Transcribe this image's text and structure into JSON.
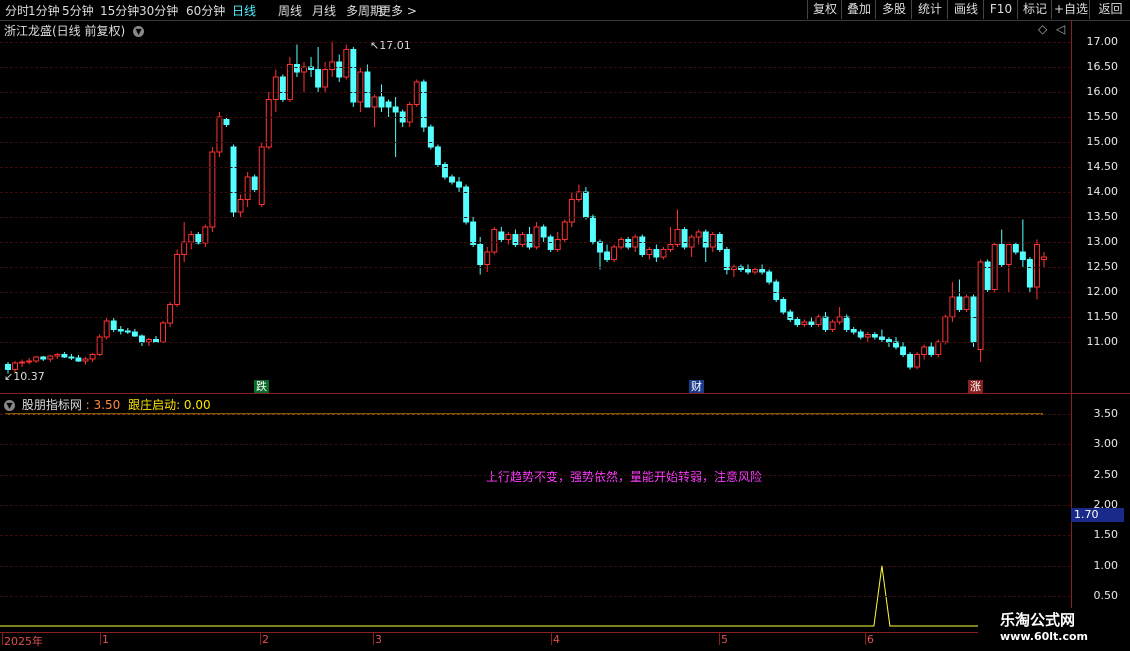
{
  "toolbar": {
    "periods": [
      "分时",
      "1分钟",
      "5分钟",
      "15分钟",
      "30分钟",
      "60分钟",
      "日线",
      "周线",
      "月线",
      "多周期",
      "更多 >"
    ],
    "active_period": "日线",
    "buttons": [
      "复权",
      "叠加",
      "多股",
      "统计",
      "画线",
      "F10",
      "标记",
      "+自选",
      "返回"
    ]
  },
  "chart_title": "浙江龙盛(日线 前复权)",
  "price_axis": [
    "17.00",
    "16.50",
    "16.00",
    "15.50",
    "15.00",
    "14.50",
    "14.00",
    "13.50",
    "13.00",
    "12.50",
    "12.00",
    "11.50",
    "11.00"
  ],
  "high_label": "17.01",
  "low_label": "10.37",
  "markers": {
    "die": "跌",
    "cai": "财",
    "zhang": "涨"
  },
  "indicator": {
    "name": "股朋指标网",
    "value": ": 3.50",
    "line_label": "跟庄启动: 0.00",
    "message": "上行趋势不变，强势依然，量能开始转弱，注意风险",
    "axis": [
      "3.50",
      "3.00",
      "2.50",
      "2.00",
      "1.50",
      "1.00",
      "0.50"
    ],
    "cursor_value": "1.70"
  },
  "dates": [
    "2025年",
    "1",
    "2",
    "3",
    "4",
    "5",
    "6"
  ],
  "watermark": {
    "line1": "乐淘公式网",
    "line2": "www.60lt.com"
  },
  "colors": {
    "up": "#ff3232",
    "down": "#54ffff",
    "axis": "#8a1f1f",
    "ind_line": "#ffb000",
    "spike": "#ffff40"
  },
  "chart_data": {
    "type": "candlestick",
    "candles": [
      [
        10.55,
        10.6,
        10.37,
        10.45
      ],
      [
        10.45,
        10.62,
        10.4,
        10.58
      ],
      [
        10.58,
        10.65,
        10.5,
        10.6
      ],
      [
        10.6,
        10.68,
        10.55,
        10.62
      ],
      [
        10.62,
        10.72,
        10.58,
        10.7
      ],
      [
        10.7,
        10.72,
        10.62,
        10.66
      ],
      [
        10.66,
        10.74,
        10.6,
        10.72
      ],
      [
        10.72,
        10.78,
        10.66,
        10.75
      ],
      [
        10.75,
        10.8,
        10.68,
        10.7
      ],
      [
        10.7,
        10.76,
        10.64,
        10.68
      ],
      [
        10.68,
        10.74,
        10.6,
        10.62
      ],
      [
        10.62,
        10.7,
        10.55,
        10.66
      ],
      [
        10.66,
        10.78,
        10.6,
        10.75
      ],
      [
        10.75,
        11.15,
        10.72,
        11.1
      ],
      [
        11.1,
        11.5,
        11.05,
        11.42
      ],
      [
        11.42,
        11.48,
        11.2,
        11.25
      ],
      [
        11.25,
        11.32,
        11.15,
        11.22
      ],
      [
        11.22,
        11.28,
        11.16,
        11.2
      ],
      [
        11.2,
        11.26,
        11.1,
        11.12
      ],
      [
        11.12,
        11.15,
        10.92,
        11.0
      ],
      [
        11.0,
        11.08,
        10.92,
        11.05
      ],
      [
        11.05,
        11.12,
        10.98,
        11.0
      ],
      [
        11.0,
        11.42,
        10.98,
        11.38
      ],
      [
        11.38,
        11.8,
        11.3,
        11.75
      ],
      [
        11.75,
        12.85,
        11.7,
        12.75
      ],
      [
        12.75,
        13.4,
        12.6,
        13.0
      ],
      [
        13.0,
        13.22,
        12.85,
        13.15
      ],
      [
        13.15,
        13.2,
        12.95,
        12.98
      ],
      [
        12.98,
        13.35,
        12.9,
        13.3
      ],
      [
        13.3,
        14.9,
        13.2,
        14.8
      ],
      [
        14.8,
        15.6,
        14.7,
        15.5
      ],
      [
        15.45,
        15.5,
        15.3,
        15.35
      ],
      [
        14.9,
        14.95,
        13.5,
        13.6
      ],
      [
        13.6,
        13.95,
        13.5,
        13.85
      ],
      [
        13.85,
        14.4,
        13.7,
        14.3
      ],
      [
        14.3,
        14.35,
        14.0,
        14.05
      ],
      [
        13.75,
        15.0,
        13.7,
        14.9
      ],
      [
        14.9,
        16.0,
        14.85,
        15.85
      ],
      [
        15.85,
        16.45,
        15.6,
        16.3
      ],
      [
        16.3,
        16.35,
        15.8,
        15.85
      ],
      [
        15.85,
        16.7,
        15.8,
        16.55
      ],
      [
        16.55,
        16.95,
        16.3,
        16.4
      ],
      [
        16.4,
        16.6,
        16.0,
        16.5
      ],
      [
        16.5,
        16.7,
        16.3,
        16.45
      ],
      [
        16.45,
        16.9,
        16.0,
        16.1
      ],
      [
        16.1,
        16.6,
        16.0,
        16.45
      ],
      [
        16.45,
        17.01,
        16.3,
        16.6
      ],
      [
        16.6,
        16.75,
        16.2,
        16.3
      ],
      [
        16.3,
        16.95,
        16.25,
        16.85
      ],
      [
        16.85,
        16.9,
        15.7,
        15.8
      ],
      [
        15.8,
        16.5,
        15.6,
        16.4
      ],
      [
        16.4,
        16.55,
        15.95,
        15.7
      ],
      [
        15.7,
        15.95,
        15.3,
        15.9
      ],
      [
        15.9,
        16.15,
        15.6,
        15.7
      ],
      [
        15.8,
        15.85,
        15.5,
        15.7
      ],
      [
        15.7,
        15.9,
        14.7,
        15.6
      ],
      [
        15.6,
        15.65,
        15.3,
        15.4
      ],
      [
        15.4,
        15.8,
        15.3,
        15.75
      ],
      [
        15.75,
        16.25,
        15.7,
        16.2
      ],
      [
        16.2,
        16.25,
        15.2,
        15.3
      ],
      [
        15.3,
        15.35,
        14.85,
        14.9
      ],
      [
        14.9,
        14.95,
        14.5,
        14.55
      ],
      [
        14.55,
        14.6,
        14.25,
        14.3
      ],
      [
        14.3,
        14.35,
        14.15,
        14.2
      ],
      [
        14.2,
        14.3,
        14.0,
        14.1
      ],
      [
        14.1,
        14.15,
        13.35,
        13.4
      ],
      [
        13.4,
        13.5,
        12.9,
        12.95
      ],
      [
        12.95,
        13.1,
        12.35,
        12.55
      ],
      [
        12.55,
        12.9,
        12.4,
        12.8
      ],
      [
        12.8,
        13.3,
        12.75,
        13.25
      ],
      [
        13.2,
        13.3,
        13.0,
        13.05
      ],
      [
        13.05,
        13.2,
        12.95,
        13.15
      ],
      [
        13.15,
        13.25,
        12.9,
        12.95
      ],
      [
        12.95,
        13.2,
        12.9,
        13.15
      ],
      [
        13.15,
        13.3,
        12.85,
        12.9
      ],
      [
        12.9,
        13.4,
        12.85,
        13.3
      ],
      [
        13.3,
        13.35,
        13.0,
        13.1
      ],
      [
        13.1,
        13.15,
        12.8,
        12.85
      ],
      [
        12.85,
        13.2,
        12.8,
        13.05
      ],
      [
        13.05,
        13.45,
        13.0,
        13.4
      ],
      [
        13.4,
        14.0,
        13.3,
        13.85
      ],
      [
        13.85,
        14.15,
        13.8,
        14.0
      ],
      [
        14.0,
        14.1,
        13.45,
        13.5
      ],
      [
        13.5,
        13.55,
        12.95,
        13.0
      ],
      [
        13.0,
        13.05,
        12.45,
        12.8
      ],
      [
        12.8,
        12.95,
        12.6,
        12.65
      ],
      [
        12.65,
        12.95,
        12.6,
        12.9
      ],
      [
        12.9,
        13.1,
        12.85,
        13.05
      ],
      [
        13.05,
        13.1,
        12.85,
        12.9
      ],
      [
        12.9,
        13.15,
        12.8,
        13.1
      ],
      [
        13.1,
        13.15,
        12.7,
        12.75
      ],
      [
        12.75,
        12.9,
        12.65,
        12.85
      ],
      [
        12.85,
        12.95,
        12.6,
        12.7
      ],
      [
        12.7,
        12.9,
        12.65,
        12.85
      ],
      [
        12.85,
        13.3,
        12.8,
        12.95
      ],
      [
        12.95,
        13.65,
        12.9,
        13.25
      ],
      [
        13.25,
        13.3,
        12.85,
        12.9
      ],
      [
        12.9,
        13.15,
        12.7,
        13.1
      ],
      [
        13.1,
        13.25,
        12.95,
        13.2
      ],
      [
        13.2,
        13.25,
        12.6,
        12.9
      ],
      [
        12.9,
        13.2,
        12.8,
        13.15
      ],
      [
        13.15,
        13.2,
        12.8,
        12.85
      ],
      [
        12.85,
        12.9,
        12.35,
        12.45
      ],
      [
        12.45,
        12.55,
        12.3,
        12.5
      ],
      [
        12.5,
        12.55,
        12.4,
        12.45
      ],
      [
        12.45,
        12.55,
        12.35,
        12.4
      ],
      [
        12.4,
        12.5,
        12.35,
        12.45
      ],
      [
        12.45,
        12.55,
        12.35,
        12.4
      ],
      [
        12.4,
        12.45,
        12.15,
        12.2
      ],
      [
        12.2,
        12.25,
        11.8,
        11.85
      ],
      [
        11.85,
        11.9,
        11.55,
        11.6
      ],
      [
        11.6,
        11.65,
        11.4,
        11.45
      ],
      [
        11.45,
        11.5,
        11.3,
        11.35
      ],
      [
        11.35,
        11.45,
        11.3,
        11.4
      ],
      [
        11.4,
        11.5,
        11.3,
        11.35
      ],
      [
        11.35,
        11.55,
        11.3,
        11.5
      ],
      [
        11.5,
        11.6,
        11.2,
        11.25
      ],
      [
        11.25,
        11.45,
        11.2,
        11.4
      ],
      [
        11.4,
        11.7,
        11.35,
        11.5
      ],
      [
        11.5,
        11.55,
        11.2,
        11.25
      ],
      [
        11.25,
        11.3,
        11.15,
        11.2
      ],
      [
        11.2,
        11.25,
        11.05,
        11.1
      ],
      [
        11.1,
        11.2,
        11.0,
        11.15
      ],
      [
        11.15,
        11.2,
        11.05,
        11.1
      ],
      [
        11.1,
        11.25,
        11.0,
        11.05
      ],
      [
        11.05,
        11.1,
        10.9,
        11.0
      ],
      [
        11.0,
        11.1,
        10.85,
        10.9
      ],
      [
        10.9,
        11.0,
        10.7,
        10.75
      ],
      [
        10.75,
        10.8,
        10.45,
        10.5
      ],
      [
        10.5,
        10.8,
        10.45,
        10.75
      ],
      [
        10.75,
        10.95,
        10.65,
        10.9
      ],
      [
        10.9,
        11.0,
        10.7,
        10.75
      ],
      [
        10.75,
        11.05,
        10.7,
        11.0
      ],
      [
        11.0,
        11.55,
        10.95,
        11.5
      ],
      [
        11.5,
        12.2,
        11.4,
        11.9
      ],
      [
        11.9,
        12.25,
        11.6,
        11.65
      ],
      [
        11.65,
        11.95,
        11.6,
        11.9
      ],
      [
        11.9,
        11.95,
        10.9,
        11.0
      ],
      [
        10.85,
        12.65,
        10.6,
        12.6
      ],
      [
        12.6,
        12.65,
        12.0,
        12.05
      ],
      [
        12.05,
        13.0,
        12.0,
        12.95
      ],
      [
        12.95,
        13.25,
        12.5,
        12.55
      ],
      [
        12.55,
        12.6,
        12.0,
        12.95
      ],
      [
        12.95,
        13.0,
        12.75,
        12.8
      ],
      [
        12.8,
        13.45,
        12.5,
        12.65
      ],
      [
        12.65,
        12.7,
        12.0,
        12.1
      ],
      [
        12.1,
        13.05,
        11.85,
        12.95
      ],
      [
        12.65,
        12.8,
        12.5,
        12.7
      ]
    ],
    "indicator_line": 3.5,
    "spike": {
      "index": 124,
      "value": 1.0
    },
    "ylim": [
      10.2,
      17.2
    ],
    "ind_ylim": [
      0.3,
      3.7
    ]
  }
}
